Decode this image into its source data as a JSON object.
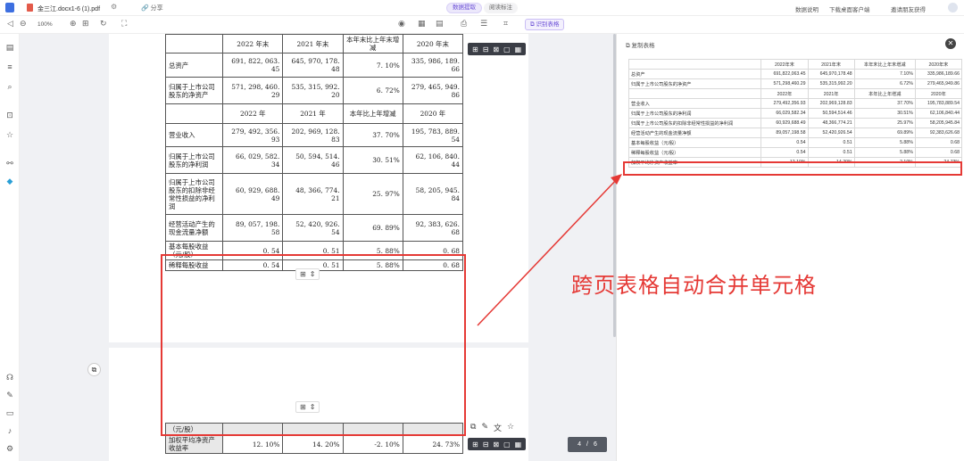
{
  "topbar": {
    "filename": "金三江.docx1-6 (1).pdf",
    "share": "分享",
    "modes": [
      "数据提取",
      "阅读标注"
    ],
    "links": [
      "数据说明",
      "下载桌面客户端",
      "邀请朋友获得"
    ]
  },
  "toolbar": {
    "zoom": "100%",
    "recognize": "识别表格"
  },
  "pdf_table_top": {
    "rows": [
      [
        "",
        "2022 年末",
        "2021 年末",
        "本年末比上年末增减",
        "2020 年末"
      ],
      [
        "总资产",
        "691, 822, 063. 45",
        "645, 970, 178. 48",
        "7. 10%",
        "335, 986, 189. 66"
      ],
      [
        "归属于上市公司股东的净资产",
        "571, 298, 460. 29",
        "535, 315, 992. 20",
        "6. 72%",
        "279, 465, 949. 86"
      ],
      [
        "",
        "2022 年",
        "2021 年",
        "本年比上年增减",
        "2020 年"
      ],
      [
        "营业收入",
        "279, 492, 356. 93",
        "202, 969, 128. 83",
        "37. 70%",
        "195, 783, 889. 54"
      ],
      [
        "归属于上市公司股东的净利润",
        "66, 029, 582. 34",
        "50, 594, 514. 46",
        "30. 51%",
        "62, 106, 840. 44"
      ],
      [
        "归属于上市公司股东的扣除非经常性损益的净利润",
        "60, 929, 688. 49",
        "48, 366, 774. 21",
        "25. 97%",
        "58, 205, 945. 84"
      ],
      [
        "经营活动产生的现金流量净额",
        "89, 057, 198. 58",
        "52, 420, 926. 54",
        "69. 89%",
        "92, 383, 626. 68"
      ],
      [
        "基本每股收益（元/股）",
        "0. 54",
        "0. 51",
        "5. 88%",
        "0. 68"
      ],
      [
        "稀释每股收益",
        "0. 54",
        "0. 51",
        "5. 88%",
        "0. 68"
      ]
    ]
  },
  "pdf_table_bottom": {
    "rows": [
      [
        "（元/股）",
        "",
        "",
        "",
        ""
      ],
      [
        "加权平均净资产收益率",
        "12. 10%",
        "14. 20%",
        "-2. 10%",
        "24. 73%"
      ]
    ]
  },
  "pager": {
    "current": "4",
    "total": "6"
  },
  "panel": {
    "title": "复制表格",
    "rows": [
      [
        "",
        "2022年末",
        "2021年末",
        "本年末比上年末增减",
        "2020年末"
      ],
      [
        "总资产",
        "691,822,063.45",
        "645,970,178.48",
        "7.10%",
        "335,986,189.66"
      ],
      [
        "归属于上市公司股东的净资产",
        "571,298,460.29",
        "535,315,992.20",
        "6.72%",
        "279,465,949.86"
      ],
      [
        "",
        "2022年",
        "2021年",
        "本年比上年增减",
        "2020年"
      ],
      [
        "营业收入",
        "279,492,356.93",
        "202,969,128.83",
        "37.70%",
        "195,783,889.54"
      ],
      [
        "归属于上市公司股东的净利润",
        "66,029,582.34",
        "50,594,514.46",
        "30.51%",
        "62,106,840.44"
      ],
      [
        "归属于上市公司股东的扣除非经常性损益的净利润",
        "60,929,688.49",
        "48,366,774.21",
        "25.97%",
        "58,205,945.84"
      ],
      [
        "经营活动产生的现金流量净额",
        "89,057,198.58",
        "52,420,926.54",
        "69.89%",
        "92,383,626.68"
      ],
      [
        "基本每股收益（元/股）",
        "0.54",
        "0.51",
        "5.88%",
        "0.68"
      ],
      [
        "稀释每股收益（元/股）",
        "0.54",
        "0.51",
        "5.88%",
        "0.68"
      ],
      [
        "加权平均净资产收益率",
        "12.10%",
        "14.20%",
        "-2.10%",
        "24.73%"
      ]
    ]
  },
  "annotation": "跨页表格自动合并单元格",
  "colors": {
    "accent": "#6a4ed6",
    "highlight": "#e53935"
  }
}
